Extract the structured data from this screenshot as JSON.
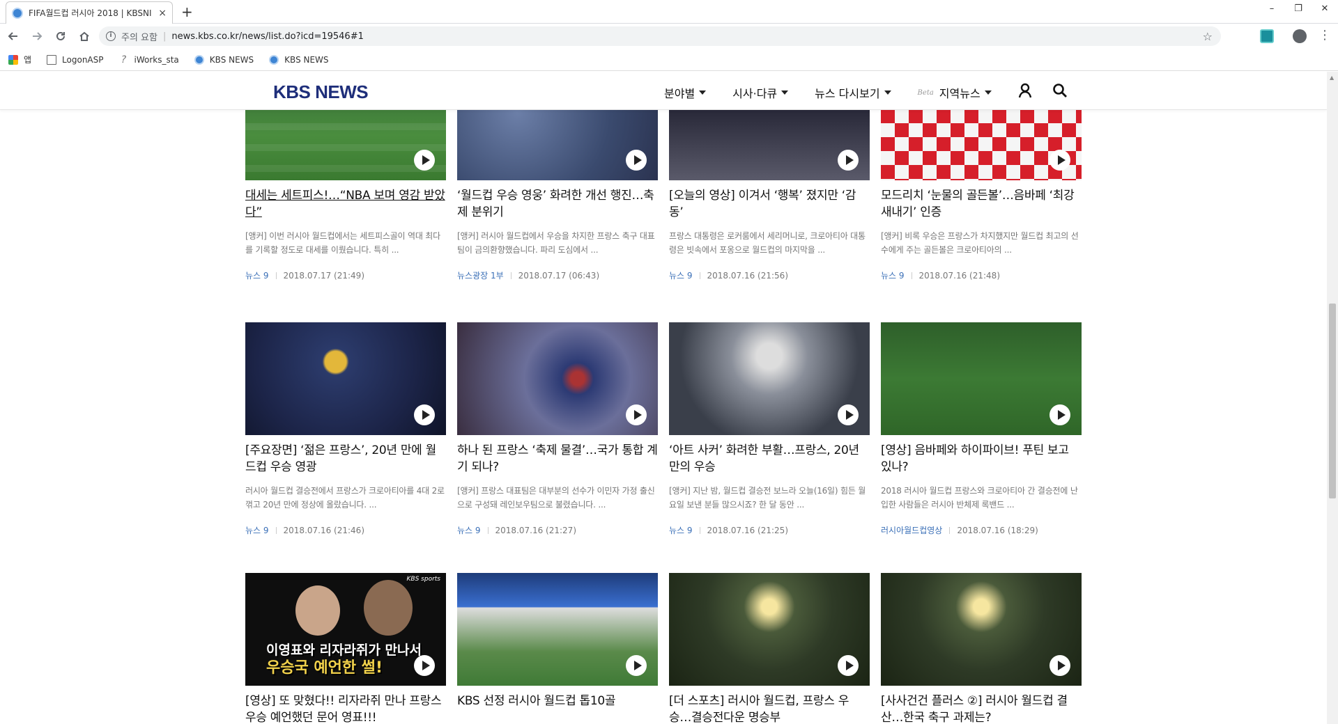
{
  "browser": {
    "tab_title": "FIFA월드컵 러시아 2018 | KBSNI",
    "tab_close": "×",
    "new_tab": "+",
    "window_controls": [
      "–",
      "❐",
      "✕"
    ],
    "security_label": "주의 요함",
    "url": "news.kbs.co.kr/news/list.do?icd=19546#1",
    "bookmarks": [
      "앱",
      "LogonASP",
      "iWorks_sta",
      "KBS NEWS",
      "KBS NEWS"
    ]
  },
  "site": {
    "logo": "KBS NEWS",
    "nav": [
      {
        "label": "분야별"
      },
      {
        "label": "시사·다큐"
      },
      {
        "label": "뉴스 다시보기"
      },
      {
        "label": "지역뉴스",
        "badge": "Beta"
      }
    ]
  },
  "articles": [
    {
      "title": "대세는 세트피스!…“NBA 보며 영감 받았다”",
      "desc": "[앵커] 이번 러시아 월드컵에서는 세트피스골이 역대 최다를 기록할 정도로 대세를 이뤘습니다. 특히 ...",
      "program": "뉴스 9",
      "date": "2018.07.17 (21:49)"
    },
    {
      "title": "‘월드컵 우승 영웅’ 화려한 개선 행진…축제 분위기",
      "desc": "[앵커] 러시아 월드컵에서 우승을 차지한 프랑스 축구 대표팀이 금의환향했습니다. 파리 도심에서 ...",
      "program": "뉴스광장 1부",
      "date": "2018.07.17 (06:43)"
    },
    {
      "title": "[오늘의 영상] 이겨서 ‘행복’ 졌지만 ‘감동’",
      "desc": "프랑스 대통령은 로커룸에서 세리머니로, 크로아티아 대통령은 빗속에서 포옹으로 월드컵의 마지막을 ...",
      "program": "뉴스 9",
      "date": "2018.07.16 (21:56)"
    },
    {
      "title": "모드리치 ‘눈물의 골든볼’…음바페 ‘최강 새내기’ 인증",
      "desc": "[앵커] 비록 우승은 프랑스가 차지했지만 월드컵 최고의 선수에게 주는 골든볼은 크로아티아의 ...",
      "program": "뉴스 9",
      "date": "2018.07.16 (21:48)"
    },
    {
      "title": "[주요장면] ‘젊은 프랑스’, 20년 만에 월드컵 우승 영광",
      "desc": "러시아 월드컵 결승전에서 프랑스가 크로아티아를 4대 2로 꺾고 20년 만에 정상에 올랐습니다. ...",
      "program": "뉴스 9",
      "date": "2018.07.16 (21:46)"
    },
    {
      "title": "하나 된 프랑스 ‘축제 물결’…국가 통합 계기 되나?",
      "desc": "[앵커] 프랑스 대표팀은 대부분의 선수가 이민자 가정 출신으로 구성돼 레인보우팀으로 불렸습니다. ...",
      "program": "뉴스 9",
      "date": "2018.07.16 (21:27)"
    },
    {
      "title": "‘아트 사커’ 화려한 부활…프랑스, 20년 만의 우승",
      "desc": "[앵커] 지난 밤, 월드컵 결승전 보느라 오늘(16일) 힘든 월요일 보낸 분들 많으시죠? 한 달 동안 ...",
      "program": "뉴스 9",
      "date": "2018.07.16 (21:25)"
    },
    {
      "title": "[영상] 음바페와 하이파이브! 푸틴 보고 있나?",
      "desc": "2018 러시아 월드컵 프랑스와 크로아티아 간 결승전에 난입한 사람들은 러시아 반체제 록밴드 ...",
      "program": "러시아월드컵영상",
      "date": "2018.07.16 (18:29)"
    },
    {
      "title": "[영상] 또 맞혔다!! 리자라쥐 만나 프랑스 우승 예언했던 문어 영표!!!",
      "thumb_line1": "이영표와 리자라쥐가 만나서",
      "thumb_line2": "우승국 예언한 썰!",
      "thumb_brand": "KBS sports"
    },
    {
      "title": "KBS 선정 러시아 월드컵 톱10골"
    },
    {
      "title": "[더 스포츠] 러시아 월드컵, 프랑스 우승…결승전다운 명승부"
    },
    {
      "title": "[사사건건 플러스 ②] 러시아 월드컵 결산…한국 축구 과제는?"
    }
  ]
}
